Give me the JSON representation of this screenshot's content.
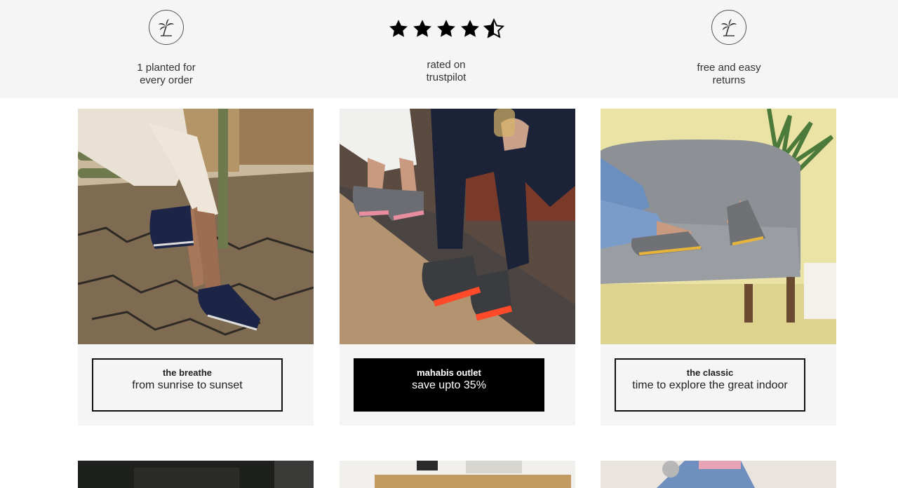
{
  "features": [
    {
      "icon": "palm-tree-icon",
      "label": "1 planted for\nevery order"
    },
    {
      "icon": "star-rating-icon",
      "rating": 4.5,
      "label": "rated on\ntrustpilot"
    },
    {
      "icon": "palm-tree-icon",
      "label": "free and easy\nreturns"
    }
  ],
  "cards": [
    {
      "title": "the breathe",
      "subtitle": "from sunrise to sunset",
      "style": "outline"
    },
    {
      "title": "mahabis outlet",
      "subtitle": "save upto 35%",
      "style": "filled"
    },
    {
      "title": "the classic",
      "subtitle": "time to explore the great indoor",
      "style": "outline"
    }
  ],
  "colors": {
    "band": "#f5f5f5",
    "cta_dark": "#000000",
    "text": "#222222"
  }
}
